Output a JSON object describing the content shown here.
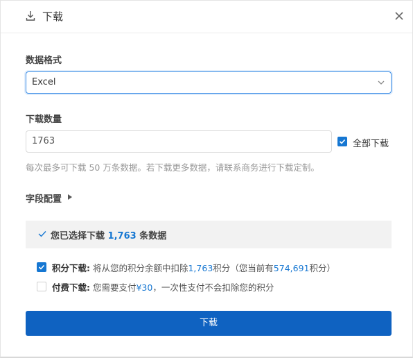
{
  "dialog": {
    "title": "下载",
    "icons": {
      "header": "download-icon",
      "close": "close-icon"
    }
  },
  "format": {
    "label": "数据格式",
    "selected": "Excel"
  },
  "count": {
    "label": "下载数量",
    "value": "1763",
    "all_label": "全部下载",
    "all_checked": true,
    "hint": "每次最多可下载 50 万条数据。若下载更多数据，请联系商务进行下载定制。"
  },
  "fields": {
    "label": "字段配置"
  },
  "summary": {
    "prefix": "您已选择下载",
    "count": "1,763",
    "suffix": "条数据"
  },
  "options": {
    "points": {
      "checked": true,
      "title": "积分下载:",
      "text_a": " 将从您的积分余额中扣除",
      "deduct": "1,763",
      "text_b": "积分（您当前有",
      "balance": "574,691",
      "text_c": "积分）"
    },
    "paid": {
      "checked": false,
      "title": "付费下载:",
      "text_a": " 您需要支付",
      "price": "¥30",
      "text_b": "，一次性支付不会扣除您的积分"
    }
  },
  "actions": {
    "download_label": "下载"
  },
  "colors": {
    "accent": "#1677d2",
    "button": "#0f62c1",
    "summary_bg": "#f2f2f2",
    "hint": "#999999"
  }
}
